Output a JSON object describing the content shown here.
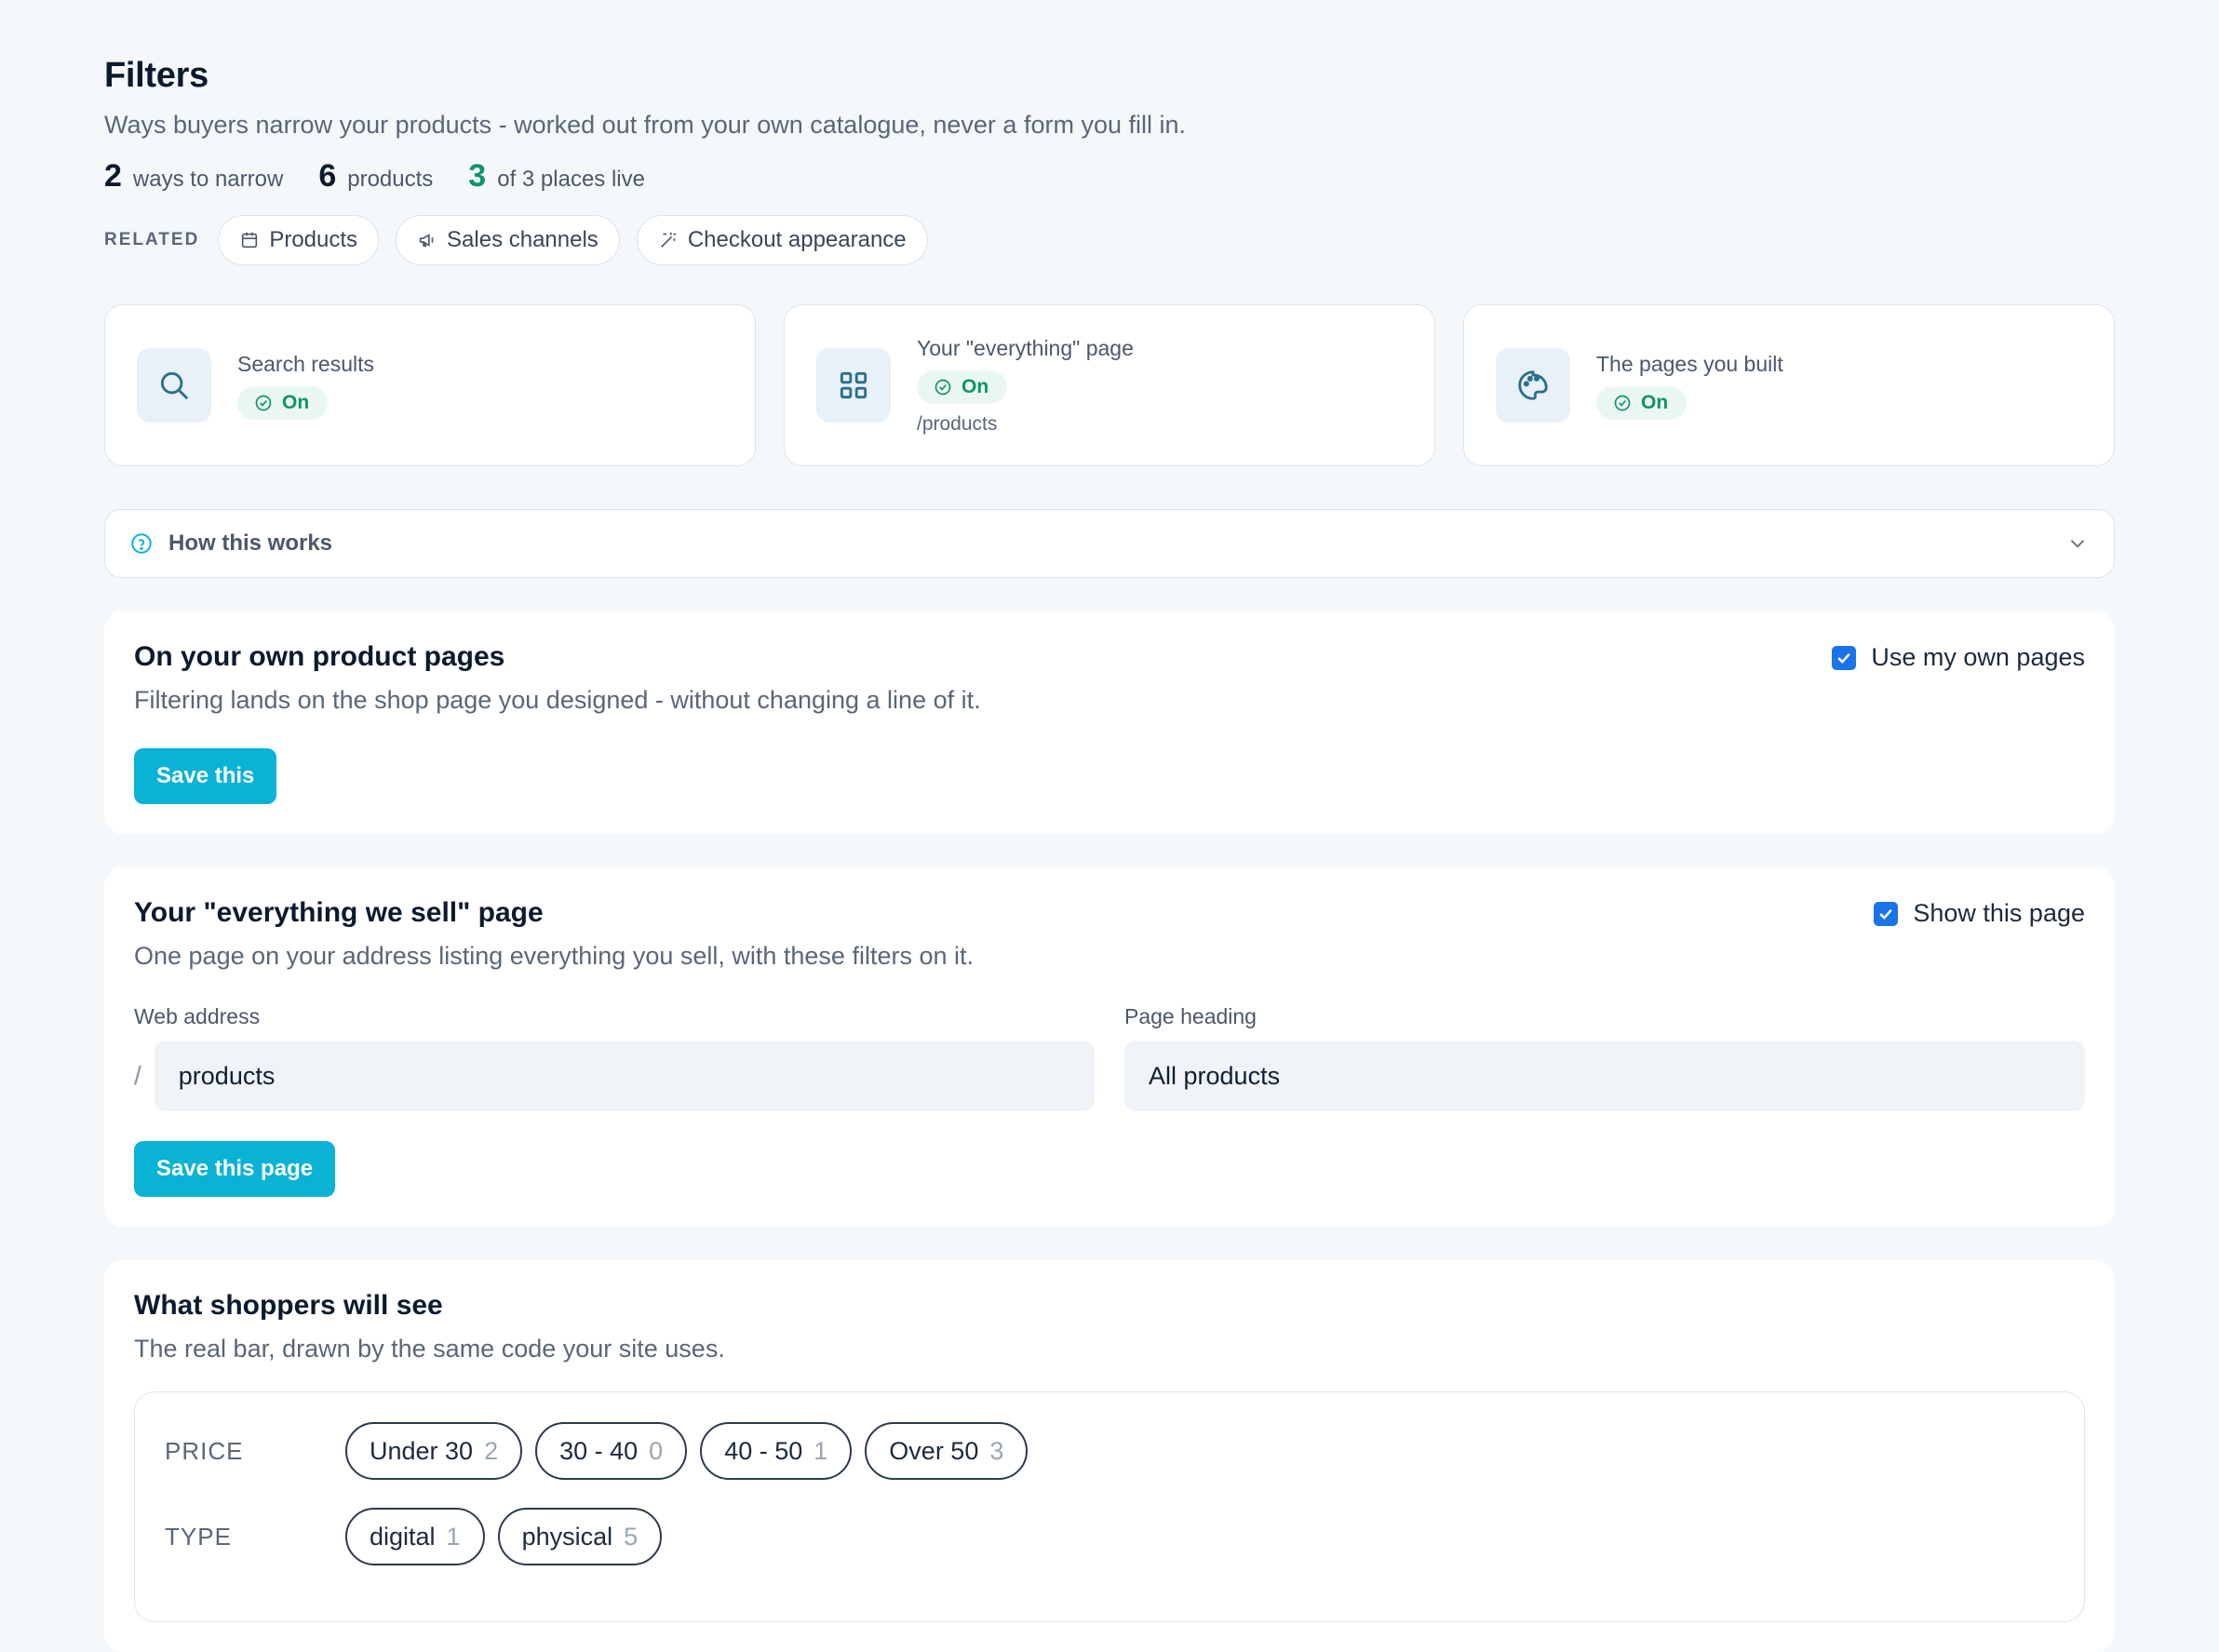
{
  "header": {
    "title": "Filters",
    "subtitle": "Ways buyers narrow your products - worked out from your own catalogue, never a form you fill in."
  },
  "stats": [
    {
      "num": "2",
      "label": "ways to narrow"
    },
    {
      "num": "6",
      "label": "products"
    },
    {
      "num": "3",
      "label": "of 3 places live"
    }
  ],
  "related": {
    "label": "RELATED",
    "links": [
      {
        "label": "Products",
        "icon": "calendar-icon"
      },
      {
        "label": "Sales channels",
        "icon": "megaphone-icon"
      },
      {
        "label": "Checkout appearance",
        "icon": "magic-wand-icon"
      }
    ]
  },
  "places": [
    {
      "name": "Search results",
      "status": "On",
      "path": "",
      "icon": "search-icon"
    },
    {
      "name": "Your \"everything\" page",
      "status": "On",
      "path": "/products",
      "icon": "grid-icon"
    },
    {
      "name": "The pages you built",
      "status": "On",
      "path": "",
      "icon": "palette-icon"
    }
  ],
  "how": {
    "label": "How this works"
  },
  "own_pages": {
    "title": "On your own product pages",
    "desc": "Filtering lands on the shop page you designed - without changing a line of it.",
    "toggle_label": "Use my own pages",
    "checked": true,
    "save_label": "Save this"
  },
  "everything_page": {
    "title": "Your \"everything we sell\" page",
    "desc": "One page on your address listing everything you sell, with these filters on it.",
    "toggle_label": "Show this page",
    "checked": true,
    "web_address_label": "Web address",
    "slash": "/",
    "web_address_value": "products",
    "heading_label": "Page heading",
    "heading_value": "All products",
    "save_label": "Save this page"
  },
  "preview": {
    "title": "What shoppers will see",
    "desc": "The real bar, drawn by the same code your site uses.",
    "rows": [
      {
        "label": "PRICE",
        "options": [
          {
            "label": "Under 30",
            "count": "2"
          },
          {
            "label": "30 - 40",
            "count": "0"
          },
          {
            "label": "40 - 50",
            "count": "1"
          },
          {
            "label": "Over 50",
            "count": "3"
          }
        ]
      },
      {
        "label": "TYPE",
        "options": [
          {
            "label": "digital",
            "count": "1"
          },
          {
            "label": "physical",
            "count": "5"
          }
        ]
      }
    ]
  },
  "colors": {
    "accent": "#0ab2d6",
    "success": "#10936a",
    "checkbox": "#1a73e8",
    "background": "#f5f8fb"
  }
}
